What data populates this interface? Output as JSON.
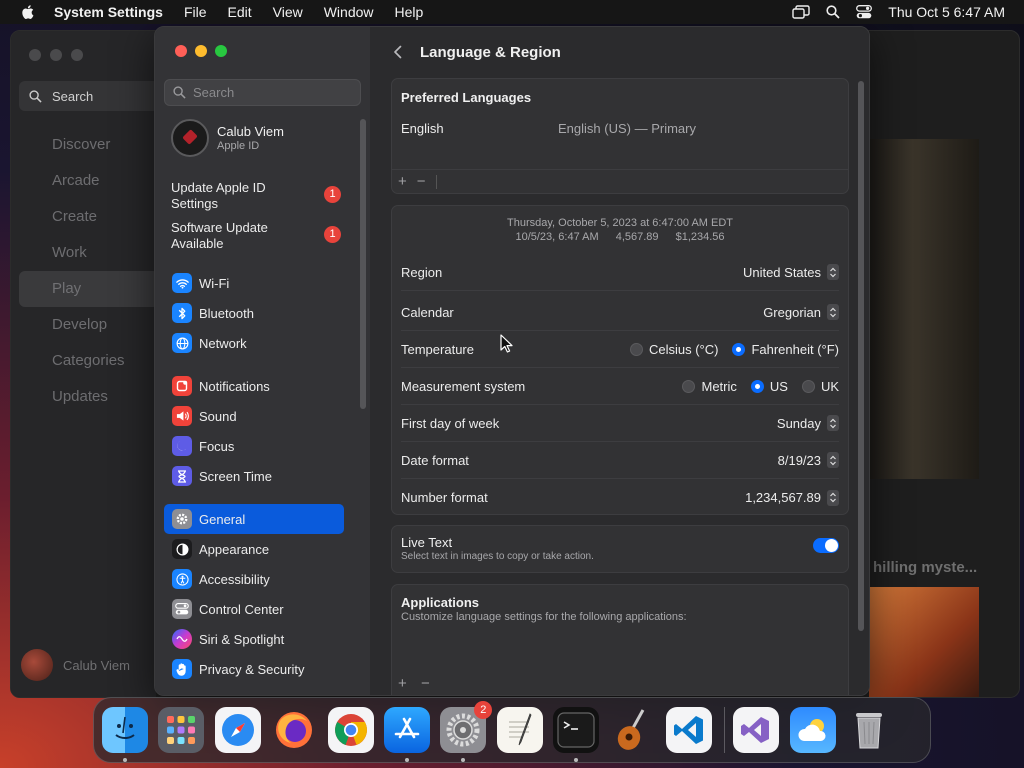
{
  "menubar": {
    "app": "System Settings",
    "items": [
      "File",
      "Edit",
      "View",
      "Window",
      "Help"
    ],
    "clock": "Thu Oct 5  6:47 AM"
  },
  "bg_app": {
    "search_label": "Search",
    "nav": [
      "Discover",
      "Arcade",
      "Create",
      "Work",
      "Play",
      "Develop",
      "Categories",
      "Updates"
    ],
    "selected": "Play",
    "user": "Calub Viem",
    "card_text": "hilling myste..."
  },
  "sidebar": {
    "search_placeholder": "Search",
    "profile_name": "Calub Viem",
    "profile_sub": "Apple ID",
    "alerts": [
      {
        "line1": "Update Apple ID",
        "line2": "Settings",
        "badge": "1"
      },
      {
        "line1": "Software Update",
        "line2": "Available",
        "badge": "1"
      }
    ],
    "group1": [
      {
        "label": "Wi-Fi",
        "icon": "wifi-icon",
        "color": "#1a84ff"
      },
      {
        "label": "Bluetooth",
        "icon": "bluetooth-icon",
        "color": "#1a84ff"
      },
      {
        "label": "Network",
        "icon": "globe-icon",
        "color": "#1a84ff"
      }
    ],
    "group2": [
      {
        "label": "Notifications",
        "icon": "bell-icon",
        "color": "#f0433a"
      },
      {
        "label": "Sound",
        "icon": "speaker-icon",
        "color": "#f0433a"
      },
      {
        "label": "Focus",
        "icon": "moon-icon",
        "color": "#5e5ce6"
      },
      {
        "label": "Screen Time",
        "icon": "hourglass-icon",
        "color": "#5e5ce6"
      }
    ],
    "group3": [
      {
        "label": "General",
        "icon": "gear-icon",
        "color": "#8e8e93"
      },
      {
        "label": "Appearance",
        "icon": "appearance-icon",
        "color": "#1c1c1e"
      },
      {
        "label": "Accessibility",
        "icon": "accessibility-icon",
        "color": "#1a84ff"
      },
      {
        "label": "Control Center",
        "icon": "toggles-icon",
        "color": "#8e8e93"
      },
      {
        "label": "Siri & Spotlight",
        "icon": "siri-icon",
        "color": "#b03fd8"
      },
      {
        "label": "Privacy & Security",
        "icon": "hand-icon",
        "color": "#1a84ff"
      }
    ],
    "selected": "General"
  },
  "content": {
    "title": "Language & Region",
    "preferred_header": "Preferred Languages",
    "language": "English",
    "language_desc": "English (US) — Primary",
    "format_line1": "Thursday, October 5, 2023 at 6:47:00 AM EDT",
    "format_line2": [
      "10/5/23, 6:47 AM",
      "4,567.89",
      "$1,234.56"
    ],
    "rows": {
      "region": {
        "label": "Region",
        "value": "United States"
      },
      "calendar": {
        "label": "Calendar",
        "value": "Gregorian"
      },
      "temperature": {
        "label": "Temperature",
        "options": [
          "Celsius (°C)",
          "Fahrenheit (°F)"
        ],
        "selected": "Fahrenheit (°F)"
      },
      "measurement": {
        "label": "Measurement system",
        "options": [
          "Metric",
          "US",
          "UK"
        ],
        "selected": "US"
      },
      "first_day": {
        "label": "First day of week",
        "value": "Sunday"
      },
      "date_format": {
        "label": "Date format",
        "value": "8/19/23"
      },
      "number_format": {
        "label": "Number format",
        "value": "1,234,567.89"
      }
    },
    "live_text": {
      "title": "Live Text",
      "subtitle": "Select text in images to copy or take action.",
      "enabled": true
    },
    "applications": {
      "title": "Applications",
      "subtitle": "Customize language settings for the following applications:"
    },
    "plus": "+",
    "minus": "−"
  },
  "dock": {
    "apps": [
      "Finder",
      "Launchpad",
      "Safari",
      "Firefox",
      "Chrome",
      "App Store",
      "System Settings",
      "TextEdit",
      "Terminal",
      "GarageBand",
      "VS Code",
      "Visual Studio",
      "Weather",
      "Trash"
    ],
    "settings_badge": "2",
    "accent": "#0a5bdc"
  }
}
